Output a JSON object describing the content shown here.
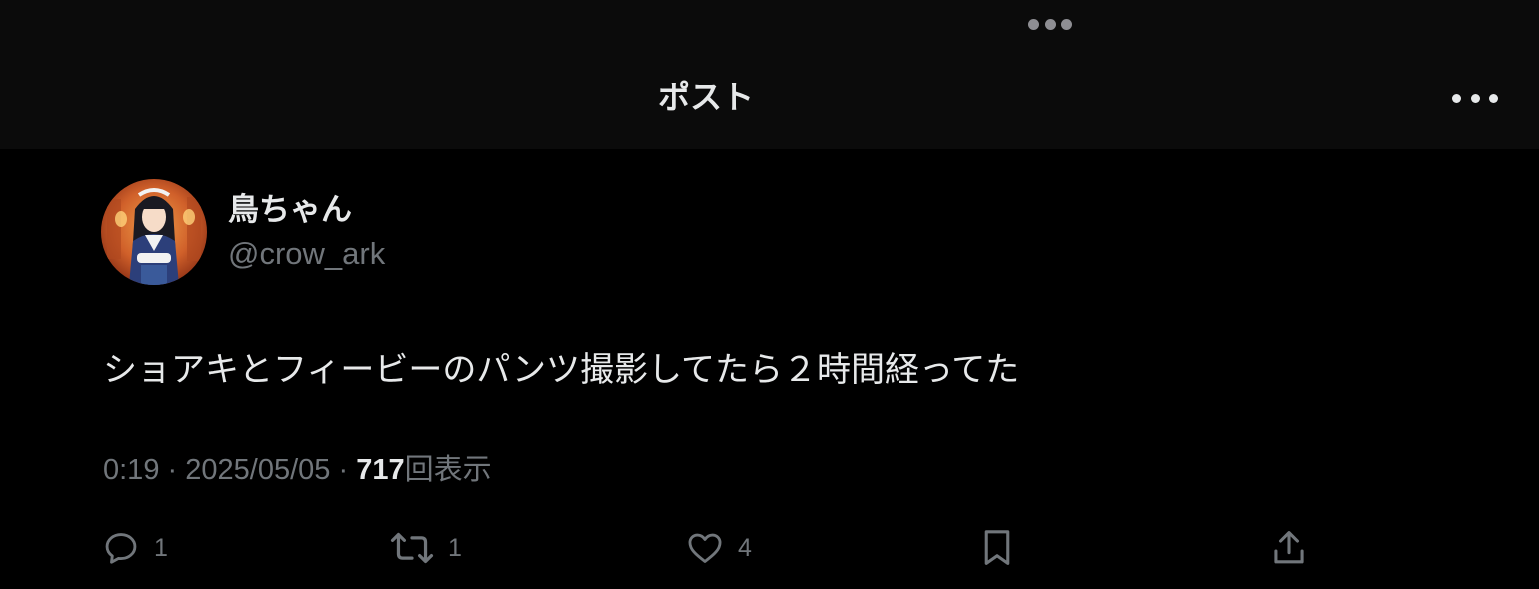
{
  "header": {
    "title": "ポスト",
    "drag_handle_icon": "ellipsis-icon",
    "more_icon": "ellipsis-icon"
  },
  "post": {
    "author": {
      "display_name": "鳥ちゃん",
      "handle": "@crow_ark",
      "avatar": "profile-avatar"
    },
    "text": "ショアキとフィービーのパンツ撮影してたら２時間経ってた",
    "time": "0:19",
    "separator": "·",
    "date": "2025/05/05",
    "views_count": "717",
    "views_label": "回表示"
  },
  "actions": {
    "reply": {
      "icon": "reply-icon",
      "count": "1"
    },
    "repost": {
      "icon": "repost-icon",
      "count": "1"
    },
    "like": {
      "icon": "heart-icon",
      "count": "4"
    },
    "bookmark": {
      "icon": "bookmark-icon"
    },
    "share": {
      "icon": "share-icon"
    }
  },
  "colors": {
    "background": "#000000",
    "header_background": "#0b0b0b",
    "primary_text": "#e7e9ea",
    "secondary_text": "#71767b"
  }
}
